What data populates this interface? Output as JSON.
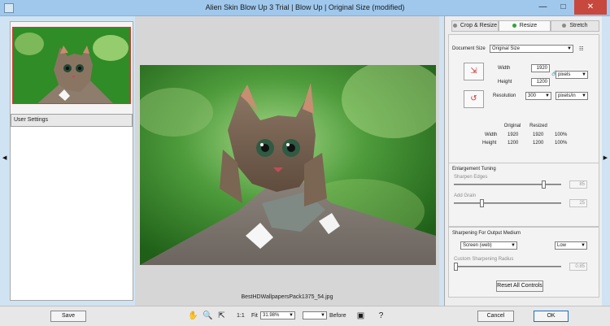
{
  "window": {
    "title": "Alien Skin Blow Up 3 Trial | Blow Up | Original Size (modified)"
  },
  "left_panel": {
    "user_settings": "User Settings"
  },
  "preview": {
    "filename": "BestHDWallpapersPack1375_54.jpg"
  },
  "right_panel": {
    "tabs": [
      {
        "label": "Crop & Resize"
      },
      {
        "label": "Resize"
      },
      {
        "label": "Stretch"
      }
    ],
    "doc_size_label": "Document Size",
    "doc_size_value": "Original Size",
    "width_label": "Width",
    "width_value": "1920",
    "height_label": "Height",
    "height_value": "1200",
    "unit_value": "pixels",
    "resolution_label": "Resolution",
    "resolution_value": "300",
    "resolution_unit": "pixels/in",
    "table": {
      "headers": [
        "",
        "Original",
        "Resized",
        ""
      ],
      "rows": [
        [
          "Width",
          "1920",
          "1920",
          "100%"
        ],
        [
          "Height",
          "1200",
          "1200",
          "100%"
        ]
      ]
    },
    "enl_title": "Enlargement Tuning",
    "sharpen_label": "Sharpen Edges",
    "sharpen_value": "85",
    "sharpen_level": 0.85,
    "grain_label": "Add Grain",
    "grain_value": "25",
    "grain_level": 0.25,
    "sharp_title": "Sharpening For Output Medium",
    "medium_value": "Screen (web)",
    "medium_level": "Low",
    "radius_label": "Custom Sharpening Radius",
    "radius_value": "0.85",
    "radius_level": 0.0,
    "reset_label": "Reset All Controls"
  },
  "statusbar": {
    "save_label": "Save",
    "ratio_label": "1:1",
    "fit_label": "Fit",
    "zoom_value": "31.98%",
    "before_label": "Before",
    "cancel_label": "Cancel",
    "ok_label": "OK"
  }
}
